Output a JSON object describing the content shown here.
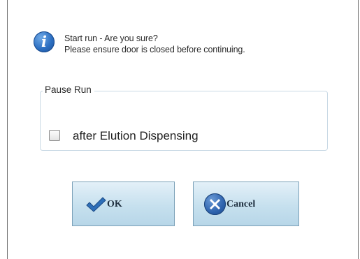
{
  "dialog": {
    "message_line1": "Start run - Are you sure?",
    "message_line2": "Please ensure door is closed before continuing.",
    "info_icon": "info-icon"
  },
  "pause_group": {
    "legend": "Pause Run",
    "option_label": "after Elution Dispensing",
    "option_checked": false
  },
  "buttons": {
    "ok_label": "OK",
    "ok_icon": "check-icon",
    "cancel_label": "Cancel",
    "cancel_icon": "close-icon"
  },
  "colors": {
    "button_fill": "#c6e0ee",
    "button_border": "#7aa0b8",
    "icon_blue": "#2c6fc2",
    "group_border": "#c9d9e5"
  }
}
